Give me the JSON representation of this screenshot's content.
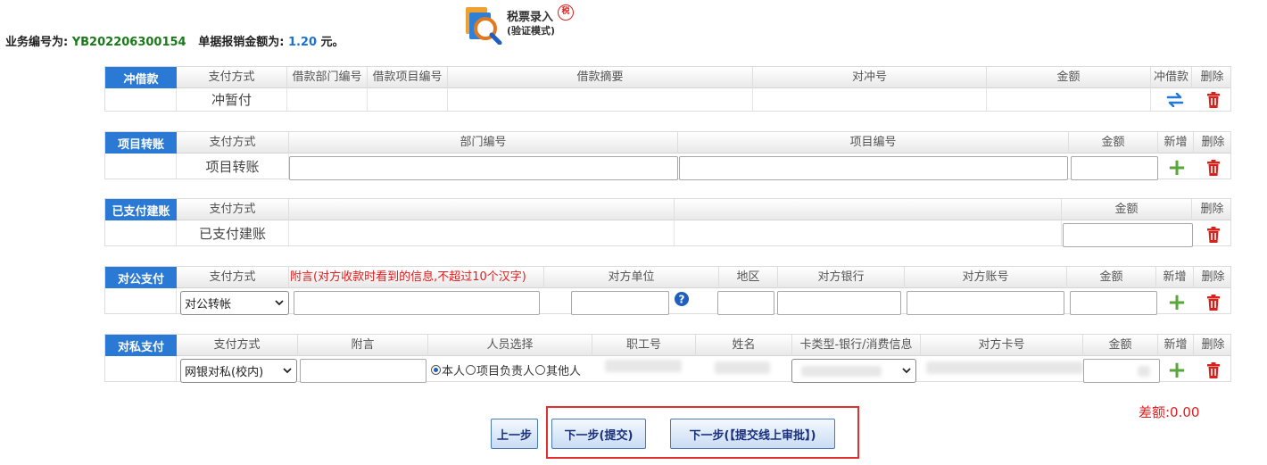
{
  "header": {
    "biz_label": "业务编号为:",
    "biz_no": "YB202206300154",
    "amount_label": "单据报销金额为:",
    "amount": "1.20",
    "amount_unit": "元。",
    "tax_title": "税票录入",
    "tax_mode": "(验证模式)",
    "stamp": "税"
  },
  "loan": {
    "label": "冲借款",
    "headers": [
      "支付方式",
      "借款部门编号",
      "借款项目编号",
      "借款摘要",
      "对冲号",
      "金额",
      "冲借款",
      "删除"
    ],
    "row_method": "冲暂付"
  },
  "project": {
    "label": "项目转账",
    "headers": [
      "支付方式",
      "部门编号",
      "项目编号",
      "金额",
      "新增",
      "删除"
    ],
    "row_method": "项目转账"
  },
  "paid": {
    "label": "已支付建账",
    "headers": [
      "支付方式",
      "金额",
      "删除"
    ],
    "row_method": "已支付建账"
  },
  "corporate": {
    "label": "对公支付",
    "headers": [
      "支付方式",
      "附言(对方收款时看到的信息,不超过10个汉字)",
      "对方单位",
      "地区",
      "对方银行",
      "对方账号",
      "金额",
      "新增",
      "删除"
    ],
    "method_selected": "对公转帐"
  },
  "private": {
    "label": "对私支付",
    "headers": [
      "支付方式",
      "附言",
      "人员选择",
      "职工号",
      "姓名",
      "卡类型-银行/消费信息",
      "对方卡号",
      "金额",
      "新增",
      "删除"
    ],
    "method_selected": "网银对私(校内)",
    "radio_options": [
      "本人",
      "项目负责人",
      "其他人"
    ]
  },
  "footer": {
    "prev": "上一步",
    "next_submit": "下一步(提交)",
    "next_online": "下一步(【提交线上审批】)",
    "diff_label": "差额:0.00"
  },
  "colors": {
    "section_blue": "#2a79d4",
    "danger": "#d9221c",
    "add": "#5aa63a",
    "swap": "#1f7ad8"
  }
}
